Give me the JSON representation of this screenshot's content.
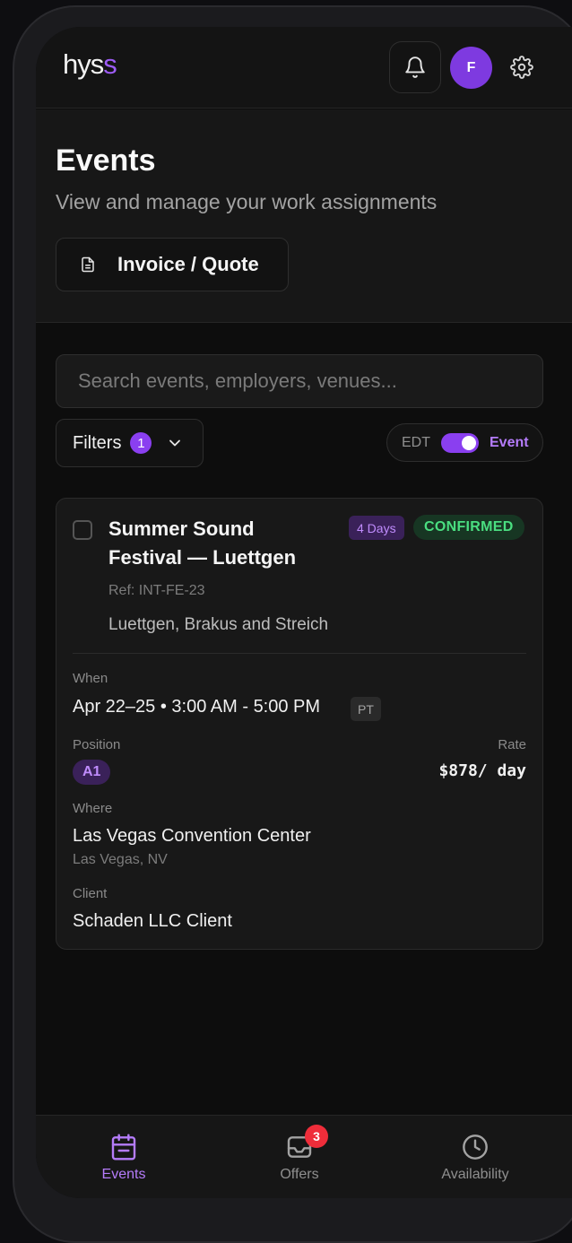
{
  "header": {
    "logo_main": "hys",
    "logo_accent": "s",
    "avatar_initial": "F"
  },
  "page": {
    "title": "Events",
    "subtitle": "View and manage your work assignments",
    "invoice_label": "Invoice / Quote"
  },
  "search": {
    "placeholder": "Search events, employers, venues...",
    "value": ""
  },
  "filters": {
    "label": "Filters",
    "count": "1"
  },
  "timezone_toggle": {
    "left_label": "EDT",
    "right_label": "Event",
    "on": true
  },
  "event": {
    "title": "Summer Sound Festival — Luettgen",
    "days_badge": "4 Days",
    "status": "CONFIRMED",
    "ref": "Ref: INT-FE-23",
    "employer": "Luettgen, Brakus and Streich",
    "when_label": "When",
    "when_value": "Apr 22–25 • 3:00 AM - 5:00 PM",
    "timezone": "PT",
    "position_label": "Position",
    "position_value": "A1",
    "rate_label": "Rate",
    "rate_value": "$878/ day",
    "where_label": "Where",
    "venue": "Las Vegas Convention Center",
    "city": "Las Vegas, NV",
    "client_label": "Client",
    "client_value": "Schaden LLC Client"
  },
  "nav": {
    "events": "Events",
    "offers": "Offers",
    "offers_badge": "3",
    "availability": "Availability"
  },
  "colors": {
    "accent": "#8a3ff0",
    "confirmed": "#4ade80",
    "badge_red": "#ef2d3a"
  }
}
